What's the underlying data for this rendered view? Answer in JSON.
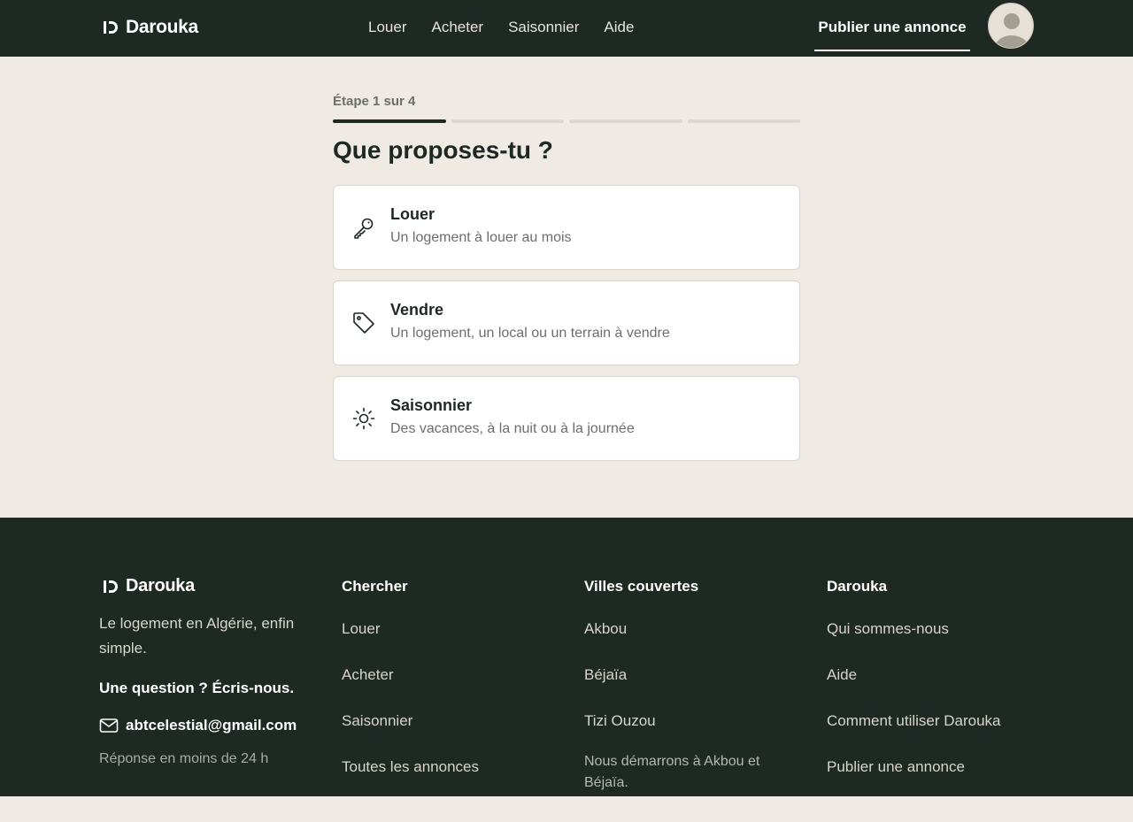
{
  "header": {
    "brand": "Darouka",
    "nav": [
      "Louer",
      "Acheter",
      "Saisonnier",
      "Aide"
    ],
    "publish_label": "Publier une annonce"
  },
  "main": {
    "step_label": "Étape 1 sur 4",
    "progress": {
      "current": 1,
      "total": 4
    },
    "title": "Que proposes-tu ?",
    "options": [
      {
        "title": "Louer",
        "subtitle": "Un logement à louer au mois",
        "icon": "key-icon"
      },
      {
        "title": "Vendre",
        "subtitle": "Un logement, un local ou un terrain à vendre",
        "icon": "tag-icon"
      },
      {
        "title": "Saisonnier",
        "subtitle": "Des vacances, à la nuit ou à la journée",
        "icon": "sun-icon"
      }
    ]
  },
  "footer": {
    "brand": "Darouka",
    "tagline": "Le logement en Algérie, enfin simple.",
    "question": "Une question ? Écris-nous.",
    "email": "abtcelestial@gmail.com",
    "reply_time": "Réponse en moins de 24 h",
    "columns": [
      {
        "heading": "Chercher",
        "links": [
          "Louer",
          "Acheter",
          "Saisonnier",
          "Toutes les annonces"
        ]
      },
      {
        "heading": "Villes couvertes",
        "links": [
          "Akbou",
          "Béjaïa",
          "Tizi Ouzou"
        ],
        "note": "Nous démarrons à Akbou et Béjaïa."
      },
      {
        "heading": "Darouka",
        "links": [
          "Qui sommes-nous",
          "Aide",
          "Comment utiliser Darouka",
          "Publier une annonce"
        ]
      }
    ]
  },
  "colors": {
    "dark": "#1e2924",
    "background": "#efeae3",
    "card": "#ffffff"
  }
}
